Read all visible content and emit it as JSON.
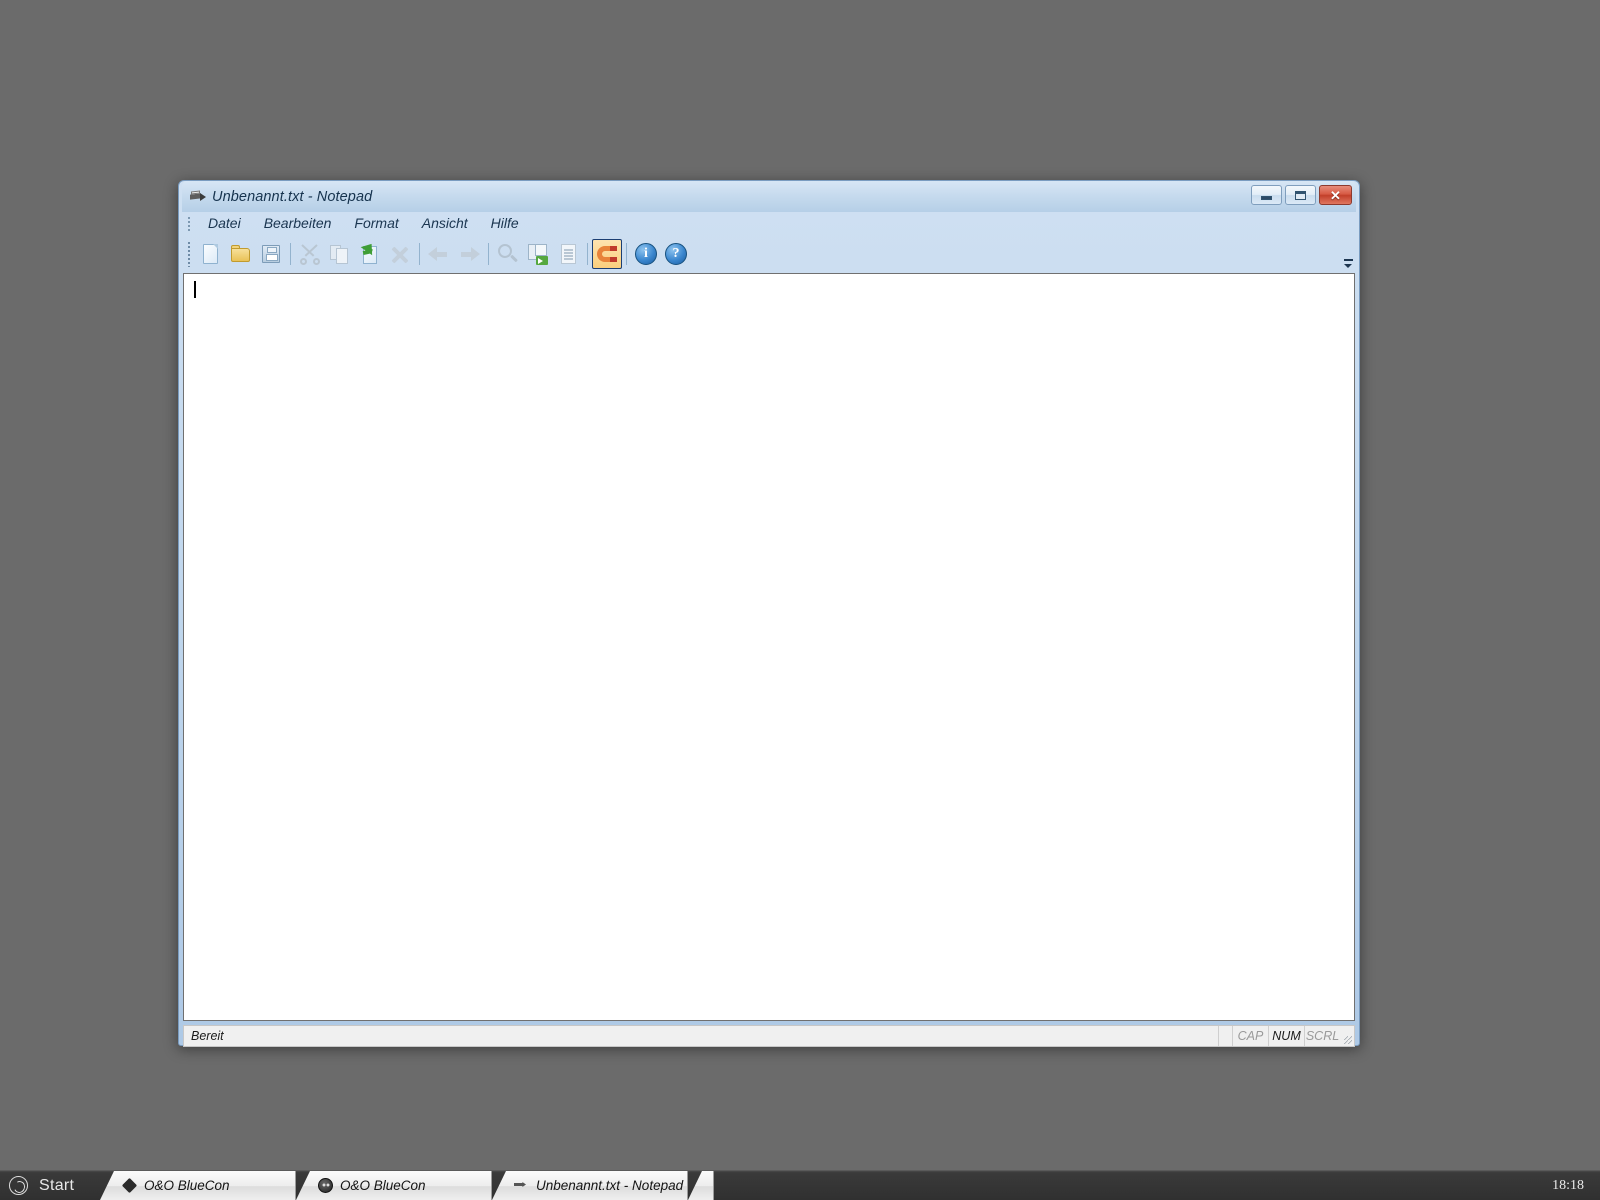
{
  "window": {
    "title": "Unbenannt.txt - Notepad",
    "app_icon": "notepad-icon",
    "buttons": {
      "minimize": "minimize-icon",
      "maximize": "maximize-icon",
      "close": "✕"
    }
  },
  "menubar": {
    "items": [
      {
        "label": "Datei"
      },
      {
        "label": "Bearbeiten"
      },
      {
        "label": "Format"
      },
      {
        "label": "Ansicht"
      },
      {
        "label": "Hilfe"
      }
    ]
  },
  "toolbar": {
    "buttons": [
      {
        "name": "new-file-button",
        "icon": "new-document-icon",
        "enabled": true,
        "selected": false
      },
      {
        "name": "open-file-button",
        "icon": "open-folder-icon",
        "enabled": true,
        "selected": false
      },
      {
        "name": "save-file-button",
        "icon": "save-floppy-icon",
        "enabled": true,
        "selected": false
      },
      {
        "name": "cut-button",
        "icon": "scissors-icon",
        "enabled": false,
        "selected": false
      },
      {
        "name": "copy-button",
        "icon": "copy-icon",
        "enabled": false,
        "selected": false
      },
      {
        "name": "paste-button",
        "icon": "paste-icon",
        "enabled": true,
        "selected": false
      },
      {
        "name": "delete-button",
        "icon": "x-delete-icon",
        "enabled": false,
        "selected": false
      },
      {
        "name": "back-button",
        "icon": "arrow-left-icon",
        "enabled": false,
        "selected": false
      },
      {
        "name": "forward-button",
        "icon": "arrow-right-icon",
        "enabled": false,
        "selected": false
      },
      {
        "name": "find-button",
        "icon": "magnifier-icon",
        "enabled": false,
        "selected": false
      },
      {
        "name": "replace-button",
        "icon": "replace-icon",
        "enabled": true,
        "selected": false
      },
      {
        "name": "properties-button",
        "icon": "document-lines-icon",
        "enabled": false,
        "selected": false
      },
      {
        "name": "magnet-button",
        "icon": "magnet-icon",
        "enabled": true,
        "selected": true
      },
      {
        "name": "info-button",
        "icon": "info-circle-icon",
        "enabled": true,
        "selected": false,
        "glyph": "i"
      },
      {
        "name": "help-button",
        "icon": "help-circle-icon",
        "enabled": true,
        "selected": false,
        "glyph": "?"
      }
    ],
    "overflow": "toolbar-overflow-chevron"
  },
  "editor": {
    "content": "",
    "caret_visible": true
  },
  "statusbar": {
    "message": "Bereit",
    "indicators": [
      {
        "label": "CAP",
        "active": false
      },
      {
        "label": "NUM",
        "active": true
      },
      {
        "label": "SCRL",
        "active": false
      }
    ]
  },
  "taskbar": {
    "start_label": "Start",
    "items": [
      {
        "label": "O&O BlueCon",
        "icon": "diamond-icon"
      },
      {
        "label": "O&O BlueCon",
        "icon": "face-icon"
      },
      {
        "label": "Unbenannt.txt - Notepad",
        "icon": "notepad-icon"
      }
    ],
    "clock": "18:18"
  },
  "colors": {
    "desktop": "#6b6b6b",
    "window_frame": "#bed5ec",
    "accent_selected": "#fbcf7d",
    "close_button": "#c23f2a",
    "taskbar": "#303030"
  }
}
